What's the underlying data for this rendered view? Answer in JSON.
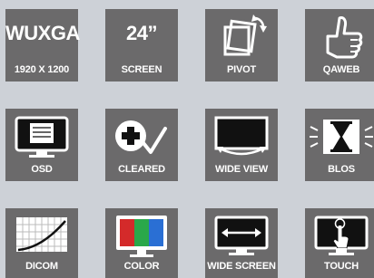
{
  "tiles": [
    {
      "big": "WUXGA",
      "caption": "1920 X 1200"
    },
    {
      "big": "24”",
      "caption": "SCREEN"
    },
    {
      "caption": "PIVOT"
    },
    {
      "caption": "QAWEB"
    },
    {
      "caption": "OSD"
    },
    {
      "caption": "CLEARED"
    },
    {
      "caption": "WIDE VIEW"
    },
    {
      "caption": "BLOS"
    },
    {
      "caption": "DICOM"
    },
    {
      "caption": "COLOR"
    },
    {
      "caption": "WIDE SCREEN"
    },
    {
      "caption": "TOUCH"
    }
  ],
  "colors": {
    "tile_bg": "#6b6a6b",
    "page_bg": "#cdd1d7",
    "icon": "#ffffff",
    "screen_dark": "#111111"
  },
  "icons": [
    "resolution-text",
    "screen-size-text",
    "pivot-icon",
    "thumbs-up-icon",
    "osd-icon",
    "cleared-icon",
    "wide-view-icon",
    "hourglass-icon",
    "dicom-curve-icon",
    "color-bars-icon",
    "wide-screen-icon",
    "touch-icon"
  ]
}
